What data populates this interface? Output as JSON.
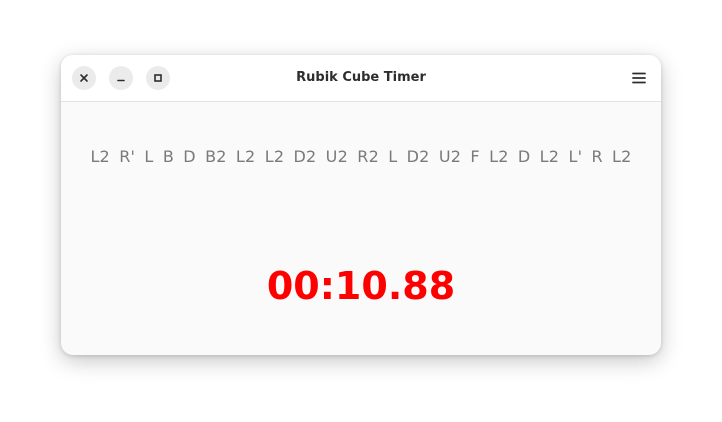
{
  "window": {
    "title": "Rubik Cube Timer"
  },
  "controls": {
    "close_icon": "close-icon",
    "minimize_icon": "minimize-icon",
    "maximize_icon": "maximize-icon",
    "menu_icon": "hamburger-menu-icon"
  },
  "scramble": {
    "text": "L2 R' L B D B2 L2 L2 D2 U2 R2 L D2 U2 F L2 D L2 L' R L2"
  },
  "timer": {
    "value": "00:10.88",
    "color": "#ff0000"
  }
}
